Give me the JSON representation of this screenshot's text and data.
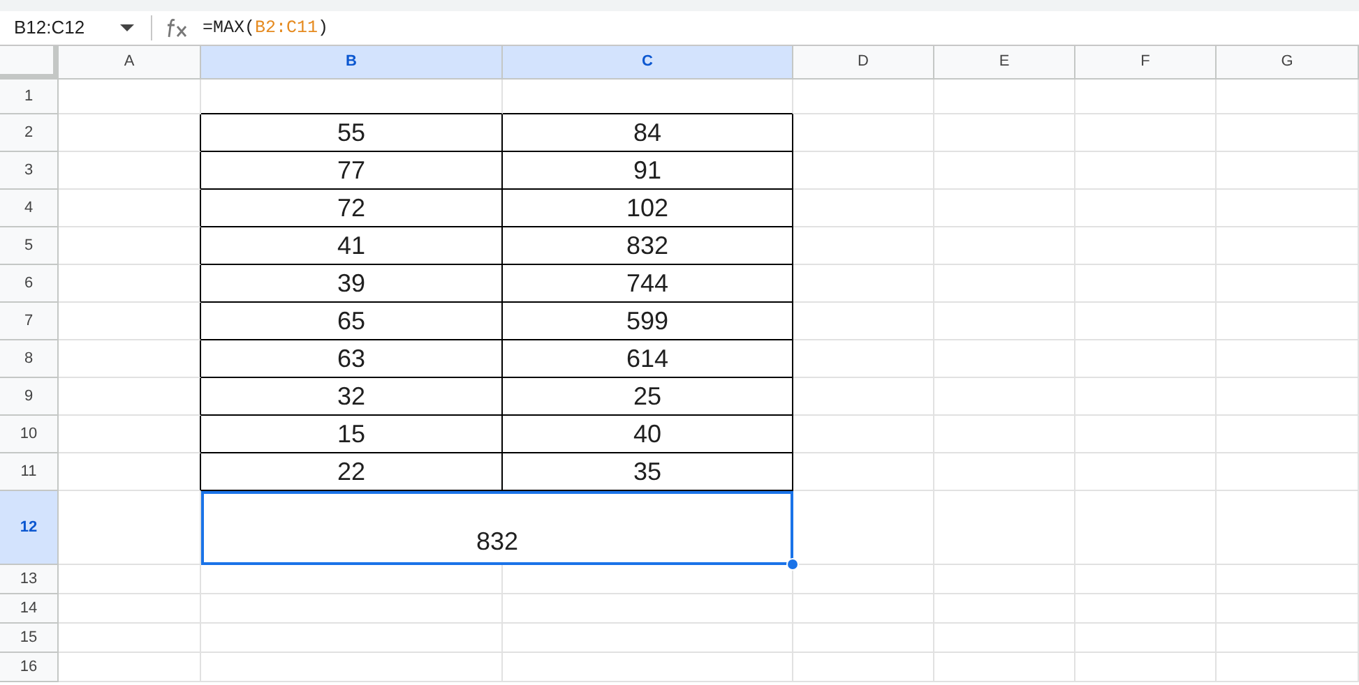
{
  "name_box": "B12:C12",
  "formula": [
    {
      "text": "=MAX(",
      "kind": "plain"
    },
    {
      "text": "B2:C11",
      "kind": "range"
    },
    {
      "text": ")",
      "kind": "plain"
    }
  ],
  "columns": [
    {
      "label": "A",
      "selected": false
    },
    {
      "label": "B",
      "selected": true
    },
    {
      "label": "C",
      "selected": true
    },
    {
      "label": "D",
      "selected": false
    },
    {
      "label": "E",
      "selected": false
    },
    {
      "label": "F",
      "selected": false
    },
    {
      "label": "G",
      "selected": false
    }
  ],
  "rows": [
    {
      "number": "1",
      "kind": "blank",
      "selected": false
    },
    {
      "number": "2",
      "kind": "data",
      "selected": false,
      "b": "55",
      "c": "84"
    },
    {
      "number": "3",
      "kind": "data",
      "selected": false,
      "b": "77",
      "c": "91"
    },
    {
      "number": "4",
      "kind": "data",
      "selected": false,
      "b": "72",
      "c": "102"
    },
    {
      "number": "5",
      "kind": "data",
      "selected": false,
      "b": "41",
      "c": "832"
    },
    {
      "number": "6",
      "kind": "data",
      "selected": false,
      "b": "39",
      "c": "744"
    },
    {
      "number": "7",
      "kind": "data",
      "selected": false,
      "b": "65",
      "c": "599"
    },
    {
      "number": "8",
      "kind": "data",
      "selected": false,
      "b": "63",
      "c": "614"
    },
    {
      "number": "9",
      "kind": "data",
      "selected": false,
      "b": "32",
      "c": "25"
    },
    {
      "number": "10",
      "kind": "data",
      "selected": false,
      "b": "15",
      "c": "40"
    },
    {
      "number": "11",
      "kind": "data",
      "selected": false,
      "b": "22",
      "c": "35"
    },
    {
      "number": "12",
      "kind": "merged",
      "selected": true,
      "value": "832"
    },
    {
      "number": "13",
      "kind": "blank",
      "selected": false
    },
    {
      "number": "14",
      "kind": "blank",
      "selected": false
    },
    {
      "number": "15",
      "kind": "blank",
      "selected": false
    },
    {
      "number": "16",
      "kind": "blank",
      "selected": false
    }
  ]
}
